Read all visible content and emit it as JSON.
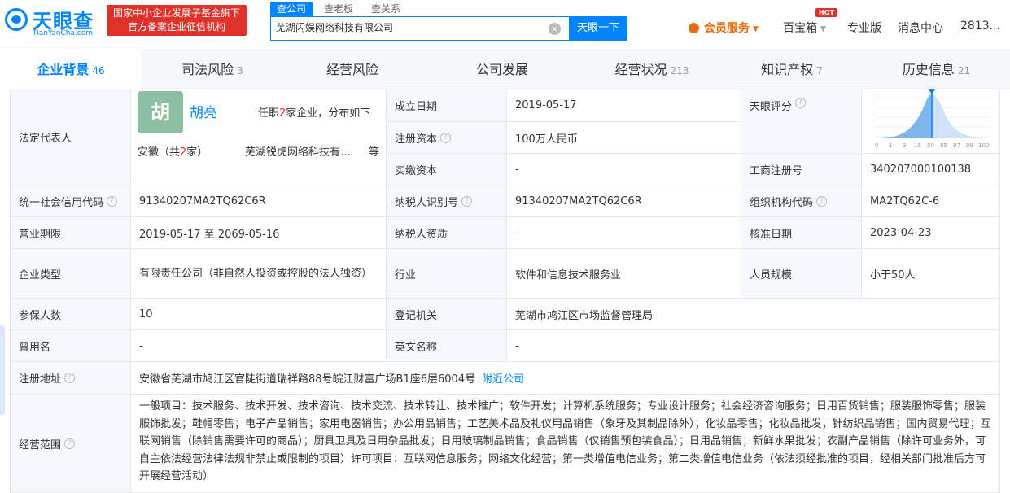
{
  "header": {
    "logo_cn": "天眼查",
    "logo_en": "TianYanCha.com",
    "gov_badge_line1": "国家中小企业发展子基金旗下",
    "gov_badge_line2": "官方备案企业征信机构",
    "search_tabs": [
      "查公司",
      "查老板",
      "查关系"
    ],
    "search_value": "芜湖闪娱网络科技有限公司",
    "search_button": "天眼一下",
    "nav": {
      "vip": "会员服务",
      "treasure": "百宝箱",
      "hot": "HOT",
      "pro": "专业版",
      "messages": "消息中心",
      "user": "2813..."
    }
  },
  "tabs": [
    {
      "label": "企业背景",
      "count": "46"
    },
    {
      "label": "司法风险",
      "count": "3"
    },
    {
      "label": "经营风险",
      "count": ""
    },
    {
      "label": "公司发展",
      "count": ""
    },
    {
      "label": "经营状况",
      "count": "213"
    },
    {
      "label": "知识产权",
      "count": "7"
    },
    {
      "label": "历史信息",
      "count": "21"
    }
  ],
  "info": {
    "legal_rep_label": "法定代表人",
    "legal_avatar": "胡",
    "legal_name": "胡亮",
    "legal_desc_pre": "任职",
    "legal_desc_num": "2",
    "legal_desc_post": "家企业，分布如下",
    "legal_region_pre": "安徽（共",
    "legal_region_num": "2",
    "legal_region_post": "家）",
    "legal_company": "芜湖锐虎网络科技有…",
    "legal_etc": "等",
    "found_date_label": "成立日期",
    "found_date": "2019-05-17",
    "reg_capital_label": "注册资本",
    "reg_capital": "100万人民币",
    "paid_capital_label": "实缴资本",
    "paid_capital": "-",
    "score_label": "天眼评分",
    "score_ticks": [
      "0",
      "1",
      "3",
      "15",
      "50",
      "85",
      "97",
      "99",
      "100"
    ],
    "biz_reg_no_label": "工商注册号",
    "biz_reg_no": "340207000100138",
    "credit_code_label": "统一社会信用代码",
    "credit_code": "91340207MA2TQ62C6R",
    "taxpayer_id_label": "纳税人识别号",
    "taxpayer_id": "91340207MA2TQ62C6R",
    "org_code_label": "组织机构代码",
    "org_code": "MA2TQ62C-6",
    "term_label": "营业期限",
    "term": "2019-05-17 至 2069-05-16",
    "taxpayer_qual_label": "纳税人资质",
    "taxpayer_qual": "-",
    "approve_date_label": "核准日期",
    "approve_date": "2023-04-23",
    "type_label": "企业类型",
    "type_value": "有限责任公司（非自然人投资或控股的法人独资）",
    "industry_label": "行业",
    "industry": "软件和信息技术服务业",
    "staff_label": "人员规模",
    "staff": "小于50人",
    "insured_label": "参保人数",
    "insured": "10",
    "authority_label": "登记机关",
    "authority": "芜湖市鸠江区市场监督管理局",
    "former_name_label": "曾用名",
    "former_name": "-",
    "en_name_label": "英文名称",
    "en_name": "-",
    "address_label": "注册地址",
    "address": "安徽省芜湖市鸠江区官陡街道瑞祥路88号皖江财富广场B1座6层6004号",
    "nearby": "附近公司",
    "scope_label": "经营范围",
    "scope": "一般项目：技术服务、技术开发、技术咨询、技术交流、技术转让、技术推广；软件开发；计算机系统服务；专业设计服务；社会经济咨询服务；日用百货销售；服装服饰零售；服装服饰批发；鞋帽零售；电子产品销售；家用电器销售；办公用品销售；工艺美术品及礼仪用品销售（象牙及其制品除外）；化妆品零售；化妆品批发；针纺织品销售；国内贸易代理；互联网销售（除销售需要许可的商品）；厨具卫具及日用杂品批发；日用玻璃制品销售；食品销售（仅销售预包装食品）；日用品销售；新鲜水果批发；农副产品销售（除许可业务外，可自主依法经营法律法规非禁止或限制的项目）许可项目：互联网信息服务；网络文化经营；第一类增值电信业务；第二类增值电信业务（依法须经批准的项目，经相关部门批准后方可开展经营活动）"
  },
  "colors": {
    "brand": "#0084ff",
    "badge_red": "#e0312a",
    "vip_orange": "#e96b0c"
  }
}
